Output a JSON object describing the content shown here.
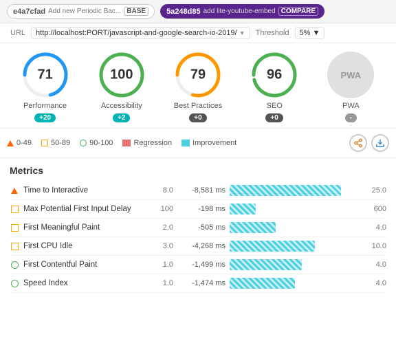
{
  "topbar": {
    "base_hash": "e4a7cfad",
    "base_message": "Add new Periodic Bac...",
    "base_type": "BASE",
    "compare_hash": "5a248d85",
    "compare_message": "add lite-youtube-embed",
    "compare_type": "COMPARE"
  },
  "urlbar": {
    "url_label": "URL",
    "url_value": "http://localhost:PORT/javascript-and-google-search-io-2019/",
    "threshold_label": "Threshold",
    "threshold_value": "5%"
  },
  "scores": [
    {
      "id": "performance",
      "label": "Performance",
      "value": "71",
      "delta": "+20",
      "delta_type": "positive",
      "color": "#2196f3",
      "stroke_pct": 0.71
    },
    {
      "id": "accessibility",
      "label": "Accessibility",
      "value": "100",
      "delta": "+2",
      "delta_type": "positive",
      "color": "#4caf50",
      "stroke_pct": 1.0
    },
    {
      "id": "best-practices",
      "label": "Best Practices",
      "value": "79",
      "delta": "+0",
      "delta_type": "zero",
      "color": "#ff9800",
      "stroke_pct": 0.79
    },
    {
      "id": "seo",
      "label": "SEO",
      "value": "96",
      "delta": "+0",
      "delta_type": "zero",
      "color": "#4caf50",
      "stroke_pct": 0.96
    },
    {
      "id": "pwa",
      "label": "PWA",
      "delta": "-",
      "delta_type": "dash"
    }
  ],
  "legend": {
    "items": [
      {
        "id": "range-0-49",
        "label": "0-49"
      },
      {
        "id": "range-50-89",
        "label": "50-89"
      },
      {
        "id": "range-90-100",
        "label": "90-100"
      },
      {
        "id": "regression",
        "label": "Regression"
      },
      {
        "id": "improvement",
        "label": "Improvement"
      }
    ]
  },
  "metrics": {
    "title": "Metrics",
    "rows": [
      {
        "id": "time-to-interactive",
        "icon": "triangle",
        "name": "Time to Interactive",
        "base": "8.0",
        "delta": "-8,581 ms",
        "bar_pct": 85,
        "threshold": "25.0"
      },
      {
        "id": "max-potential-fid",
        "icon": "square",
        "name": "Max Potential First Input Delay",
        "base": "100",
        "delta": "-198 ms",
        "bar_pct": 20,
        "threshold": "600"
      },
      {
        "id": "first-meaningful-paint",
        "icon": "square",
        "name": "First Meaningful Paint",
        "base": "2.0",
        "delta": "-505 ms",
        "bar_pct": 35,
        "threshold": "4.0"
      },
      {
        "id": "first-cpu-idle",
        "icon": "square",
        "name": "First CPU Idle",
        "base": "3.0",
        "delta": "-4,268 ms",
        "bar_pct": 65,
        "threshold": "10.0"
      },
      {
        "id": "first-contentful-paint",
        "icon": "circle",
        "name": "First Contentful Paint",
        "base": "1.0",
        "delta": "-1,499 ms",
        "bar_pct": 55,
        "threshold": "4.0"
      },
      {
        "id": "speed-index",
        "icon": "circle",
        "name": "Speed Index",
        "base": "1.0",
        "delta": "-1,474 ms",
        "bar_pct": 50,
        "threshold": "4.0"
      }
    ]
  }
}
